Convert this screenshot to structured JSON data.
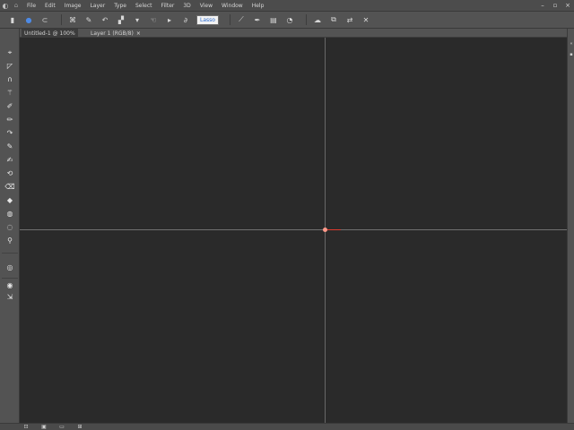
{
  "menubar": {
    "menus": [
      "File",
      "Edit",
      "Image",
      "Layer",
      "Type",
      "Select",
      "Filter",
      "3D",
      "View",
      "Window",
      "Help"
    ],
    "minimize_label": "–",
    "restore_label": "▫",
    "close_label": "×"
  },
  "options": {
    "field_value": "Lasso"
  },
  "tabs": {
    "doc_tab_label": "Untitled-1 @ 100%",
    "second_tab_label": "Layer 1 (RGB/8)"
  },
  "icons": {
    "app": "ps-logo-icon",
    "tools": [
      "move",
      "marquee",
      "lasso",
      "quick-select",
      "crop",
      "eyedropper",
      "healing",
      "brush",
      "clone",
      "history",
      "eraser",
      "gradient",
      "blur",
      "dodge",
      "pen",
      "text",
      "path-select",
      "shape",
      "hand",
      "zoom",
      "colors",
      "quick-mask",
      "screen-mode"
    ]
  },
  "colors": {
    "accent": "#4d8ae6",
    "guide": "#686868",
    "origin": "#e03a2e",
    "canvas": "#2a2a2a",
    "panel": "#535353"
  }
}
